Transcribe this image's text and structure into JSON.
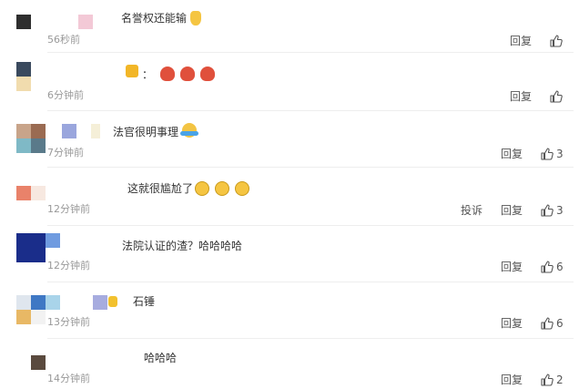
{
  "comments": [
    {
      "text": "名誉权还能输",
      "time": "56秒前",
      "reply": "回复",
      "likes": "",
      "report": ""
    },
    {
      "text": "：",
      "time": "6分钟前",
      "reply": "回复",
      "likes": "",
      "report": ""
    },
    {
      "text": "法官很明事理",
      "time": "7分钟前",
      "reply": "回复",
      "likes": "3",
      "report": ""
    },
    {
      "text": "这就很尴尬了",
      "time": "12分钟前",
      "reply": "回复",
      "likes": "3",
      "report": "投诉"
    },
    {
      "text": "法院认证的渣？哈哈哈哈",
      "time": "12分钟前",
      "reply": "回复",
      "likes": "6",
      "report": ""
    },
    {
      "text": "石锤",
      "time": "13分钟前",
      "reply": "回复",
      "likes": "6",
      "report": ""
    },
    {
      "text": "哈哈哈",
      "time": "14分钟前",
      "reply": "回复",
      "likes": "2",
      "report": ""
    }
  ],
  "colors": {
    "text": "#333333",
    "time": "#999999",
    "action": "#555555",
    "divider": "#eeeeee",
    "emoji_yellow": "#f5c542",
    "emoji_red": "#e0503c"
  },
  "icons": [
    "thumbs-up-icon",
    "thumbs-up-emoji",
    "crab-emoji",
    "laugh-emoji",
    "sweat-emoji",
    "v-badge-icon"
  ]
}
